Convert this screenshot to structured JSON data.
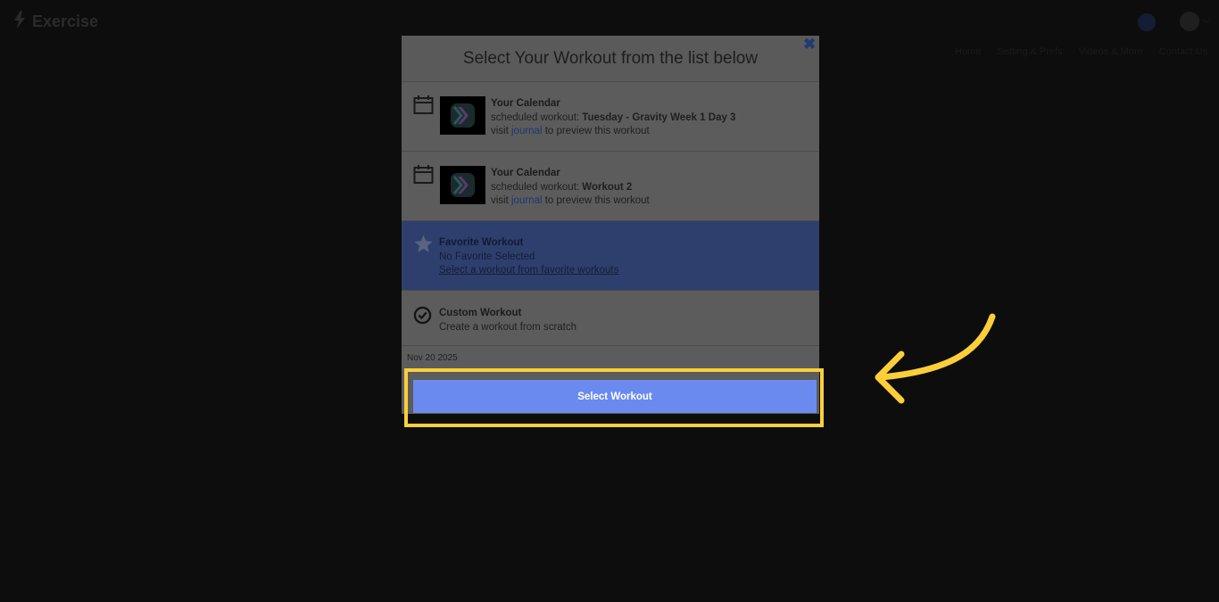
{
  "app": {
    "name": "Exercise",
    "nav": [
      "Home",
      "Setting & Prefs",
      "Videos & More",
      "Contact Us"
    ]
  },
  "modal": {
    "title": "Select Your Workout from the list below",
    "close_icon": "close-icon",
    "rows": [
      {
        "title": "Your Calendar",
        "line2_prefix": "scheduled workout: ",
        "workout_name": "Tuesday - Gravity Week 1 Day 3",
        "line3_prefix": "visit ",
        "line3_link": "journal",
        "line3_suffix": " to preview this workout",
        "icon": "calendar-icon"
      },
      {
        "title": "Your Calendar",
        "line2_prefix": "scheduled workout: ",
        "workout_name": "Workout 2",
        "line3_prefix": "visit ",
        "line3_link": "journal",
        "line3_suffix": " to preview this workout",
        "icon": "calendar-icon"
      }
    ],
    "favorite": {
      "title": "Favorite Workout",
      "status": "No Favorite Selected",
      "link": "Select a workout from favorite workouts",
      "icon": "star-icon"
    },
    "custom": {
      "title": "Custom Workout",
      "subtitle": "Create a workout from scratch",
      "icon": "check-circle-icon"
    },
    "date": "Nov 20 2025",
    "select_button": "Select Workout"
  },
  "colors": {
    "overlay": "#0d0d0d",
    "favorite_bg": "#2e3f6e",
    "button": "#6b8af0",
    "highlight": "#fccf3a"
  }
}
